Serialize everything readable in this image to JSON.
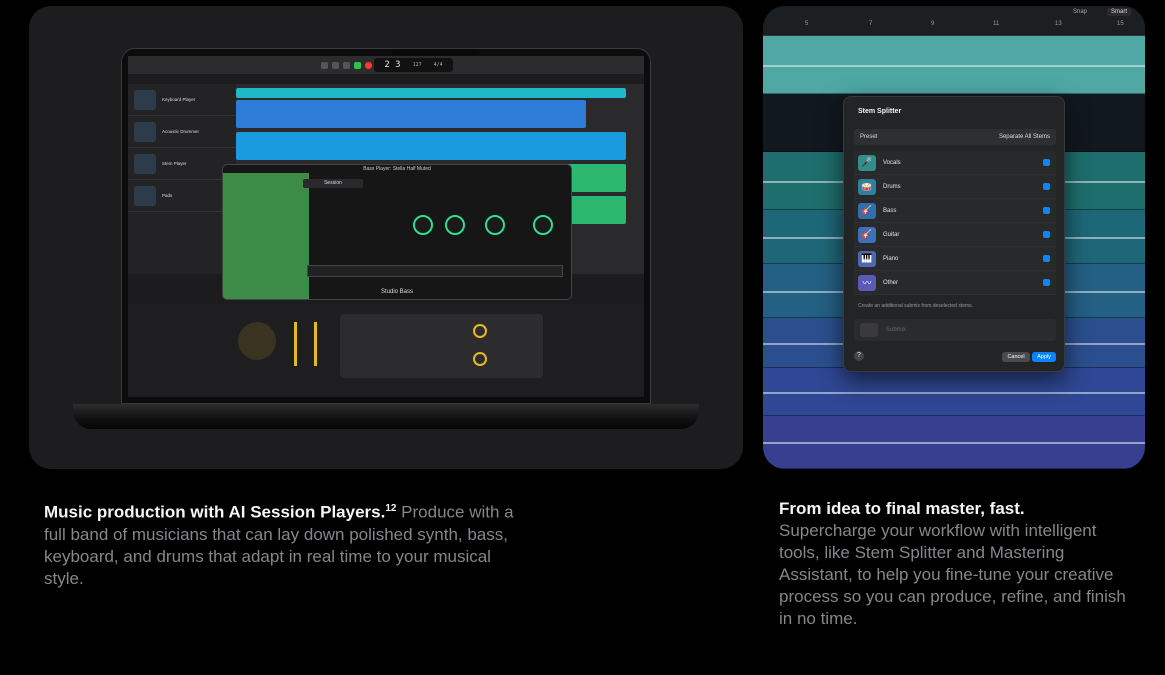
{
  "left_card": {
    "daw": {
      "lcd_bar": "2 3",
      "lcd_tempo": "127",
      "lcd_sig": "4/4",
      "tracks": [
        "Keyboard Player",
        "Acoustic Drummer",
        "Stem Player",
        "Pads"
      ],
      "plugin_title": "Bass Player: Stella Half Muted",
      "plugin_name": "Studio Bass",
      "session_label": "Session"
    }
  },
  "right_card": {
    "ruler_numbers": [
      "5",
      "7",
      "9",
      "11",
      "13",
      "15"
    ],
    "snap_label": "Snap",
    "snap_value": "Smart",
    "dialog": {
      "title": "Stem Splitter",
      "preset_label": "Preset",
      "preset_value": "Separate All Stems",
      "stems": [
        {
          "label": "Vocals",
          "icon": "microphone-icon",
          "color": "#2f8f8a"
        },
        {
          "label": "Drums",
          "icon": "drums-icon",
          "color": "#2f7fa0"
        },
        {
          "label": "Bass",
          "icon": "bass-guitar-icon",
          "color": "#2f6fb0"
        },
        {
          "label": "Guitar",
          "icon": "guitar-icon",
          "color": "#3f6fb8"
        },
        {
          "label": "Piano",
          "icon": "piano-icon",
          "color": "#4f66b8"
        },
        {
          "label": "Other",
          "icon": "waveform-icon",
          "color": "#5a5ab8"
        }
      ],
      "note": "Create an additional submix from deselected stems.",
      "submix_label": "Submix",
      "help": "?",
      "cancel": "Cancel",
      "apply": "Apply"
    }
  },
  "captions": {
    "left": {
      "heading": "Music production with AI Session Players.",
      "footnote": "12",
      "body": " Produce with a full band of musicians that can lay down polished synth, bass, keyboard, and drums that adapt in real time to your musical style."
    },
    "right": {
      "heading": "From idea to final master, fast.",
      "body": "Supercharge your workflow with intelligent tools, like Stem Splitter and Mastering Assistant, to help you fine-tune your creative process so you can produce, refine, and finish in no time."
    }
  },
  "colors": {
    "accent_blue": "#0a84ff",
    "region_cyan": "#1eb8c8",
    "region_blue": "#2c7cd8",
    "region_green": "#2db870",
    "knob_green": "#2ee08a"
  }
}
